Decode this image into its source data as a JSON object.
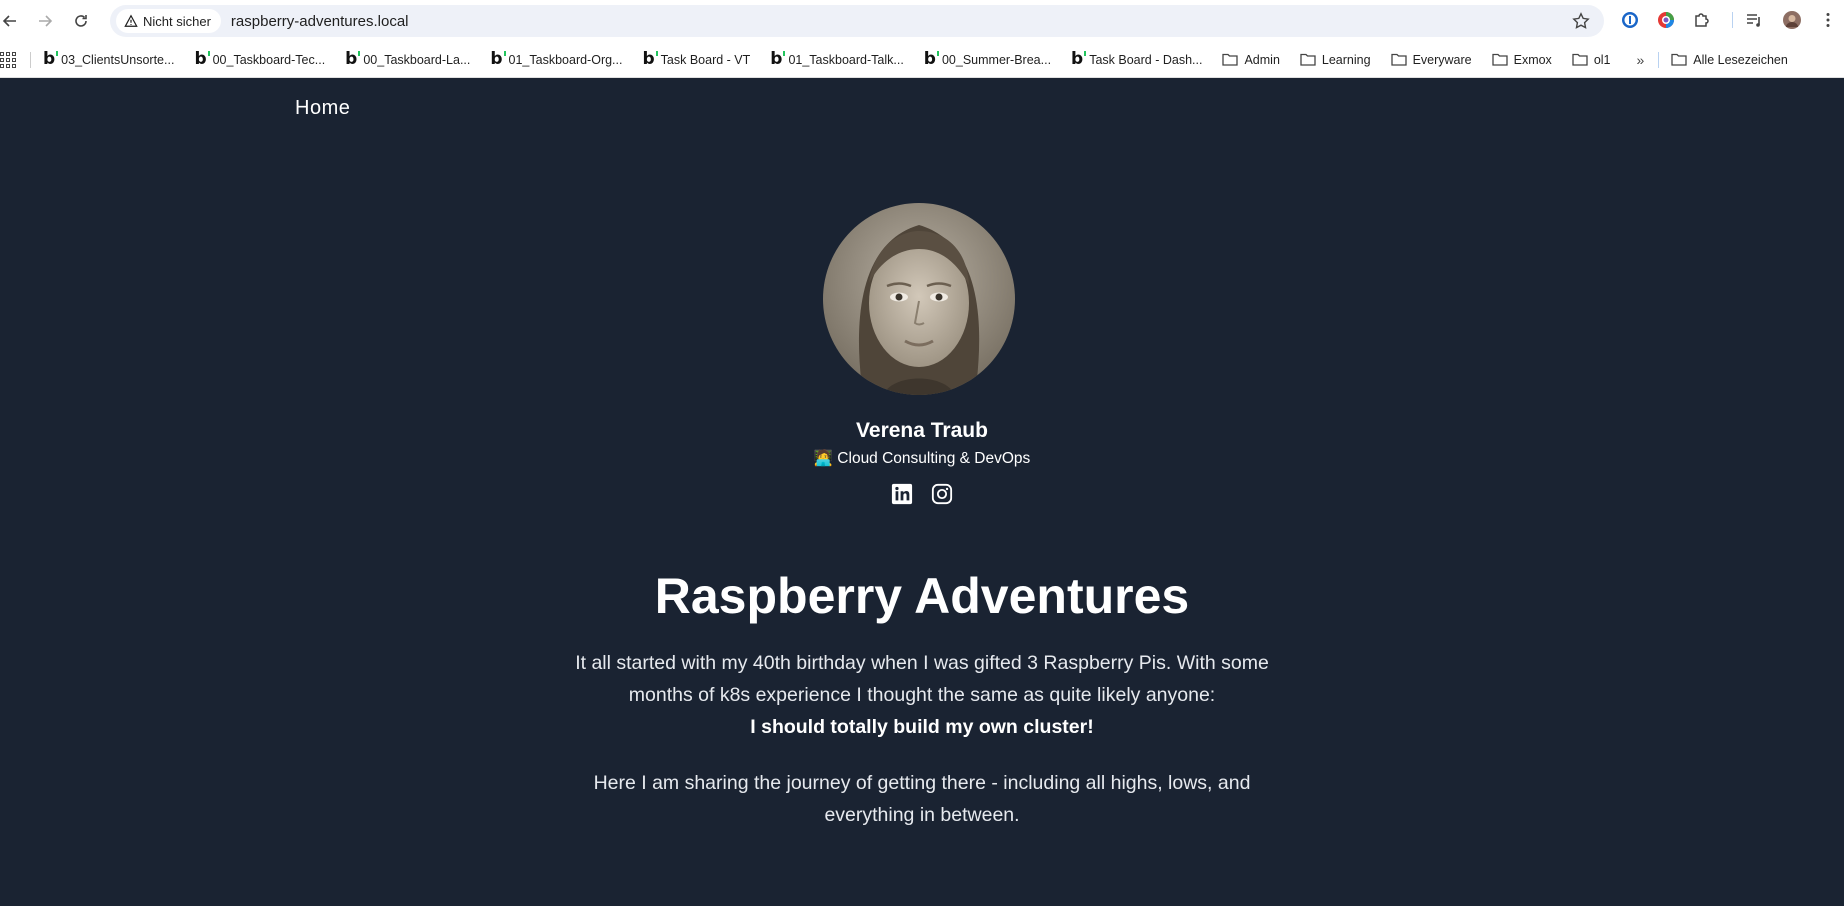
{
  "browser": {
    "security_label": "Nicht sicher",
    "url": "raspberry-adventures.local",
    "bookmarks": [
      {
        "label": "03_ClientsUnsorte...",
        "type": "bee"
      },
      {
        "label": "00_Taskboard-Tec...",
        "type": "bee"
      },
      {
        "label": "00_Taskboard-La...",
        "type": "bee"
      },
      {
        "label": "01_Taskboard-Org...",
        "type": "bee"
      },
      {
        "label": "Task Board - VT",
        "type": "bee"
      },
      {
        "label": "01_Taskboard-Talk...",
        "type": "bee"
      },
      {
        "label": "00_Summer-Brea...",
        "type": "bee"
      },
      {
        "label": "Task Board - Dash...",
        "type": "bee"
      },
      {
        "label": "Admin",
        "type": "folder"
      },
      {
        "label": "Learning",
        "type": "folder"
      },
      {
        "label": "Everyware",
        "type": "folder"
      },
      {
        "label": "Exmox",
        "type": "folder"
      },
      {
        "label": "ol1",
        "type": "folder"
      }
    ],
    "more_label": "»",
    "all_bookmarks_label": "Alle Lesezeichen"
  },
  "page": {
    "nav_home": "Home",
    "profile": {
      "name": "Verena Traub",
      "role": "🧑‍💻 Cloud Consulting & DevOps"
    },
    "hero_title": "Raspberry Adventures",
    "intro_text": "It all started with my 40th birthday when I was gifted 3 Raspberry Pis. With some months of k8s experience I thought the same as quite likely anyone:",
    "intro_bold": "I should totally build my own cluster!",
    "intro_text_2": "Here I am sharing the journey of getting there - including all highs, lows, and everything in between."
  },
  "colors": {
    "page_background": "#1a2332",
    "text": "#ffffff"
  }
}
